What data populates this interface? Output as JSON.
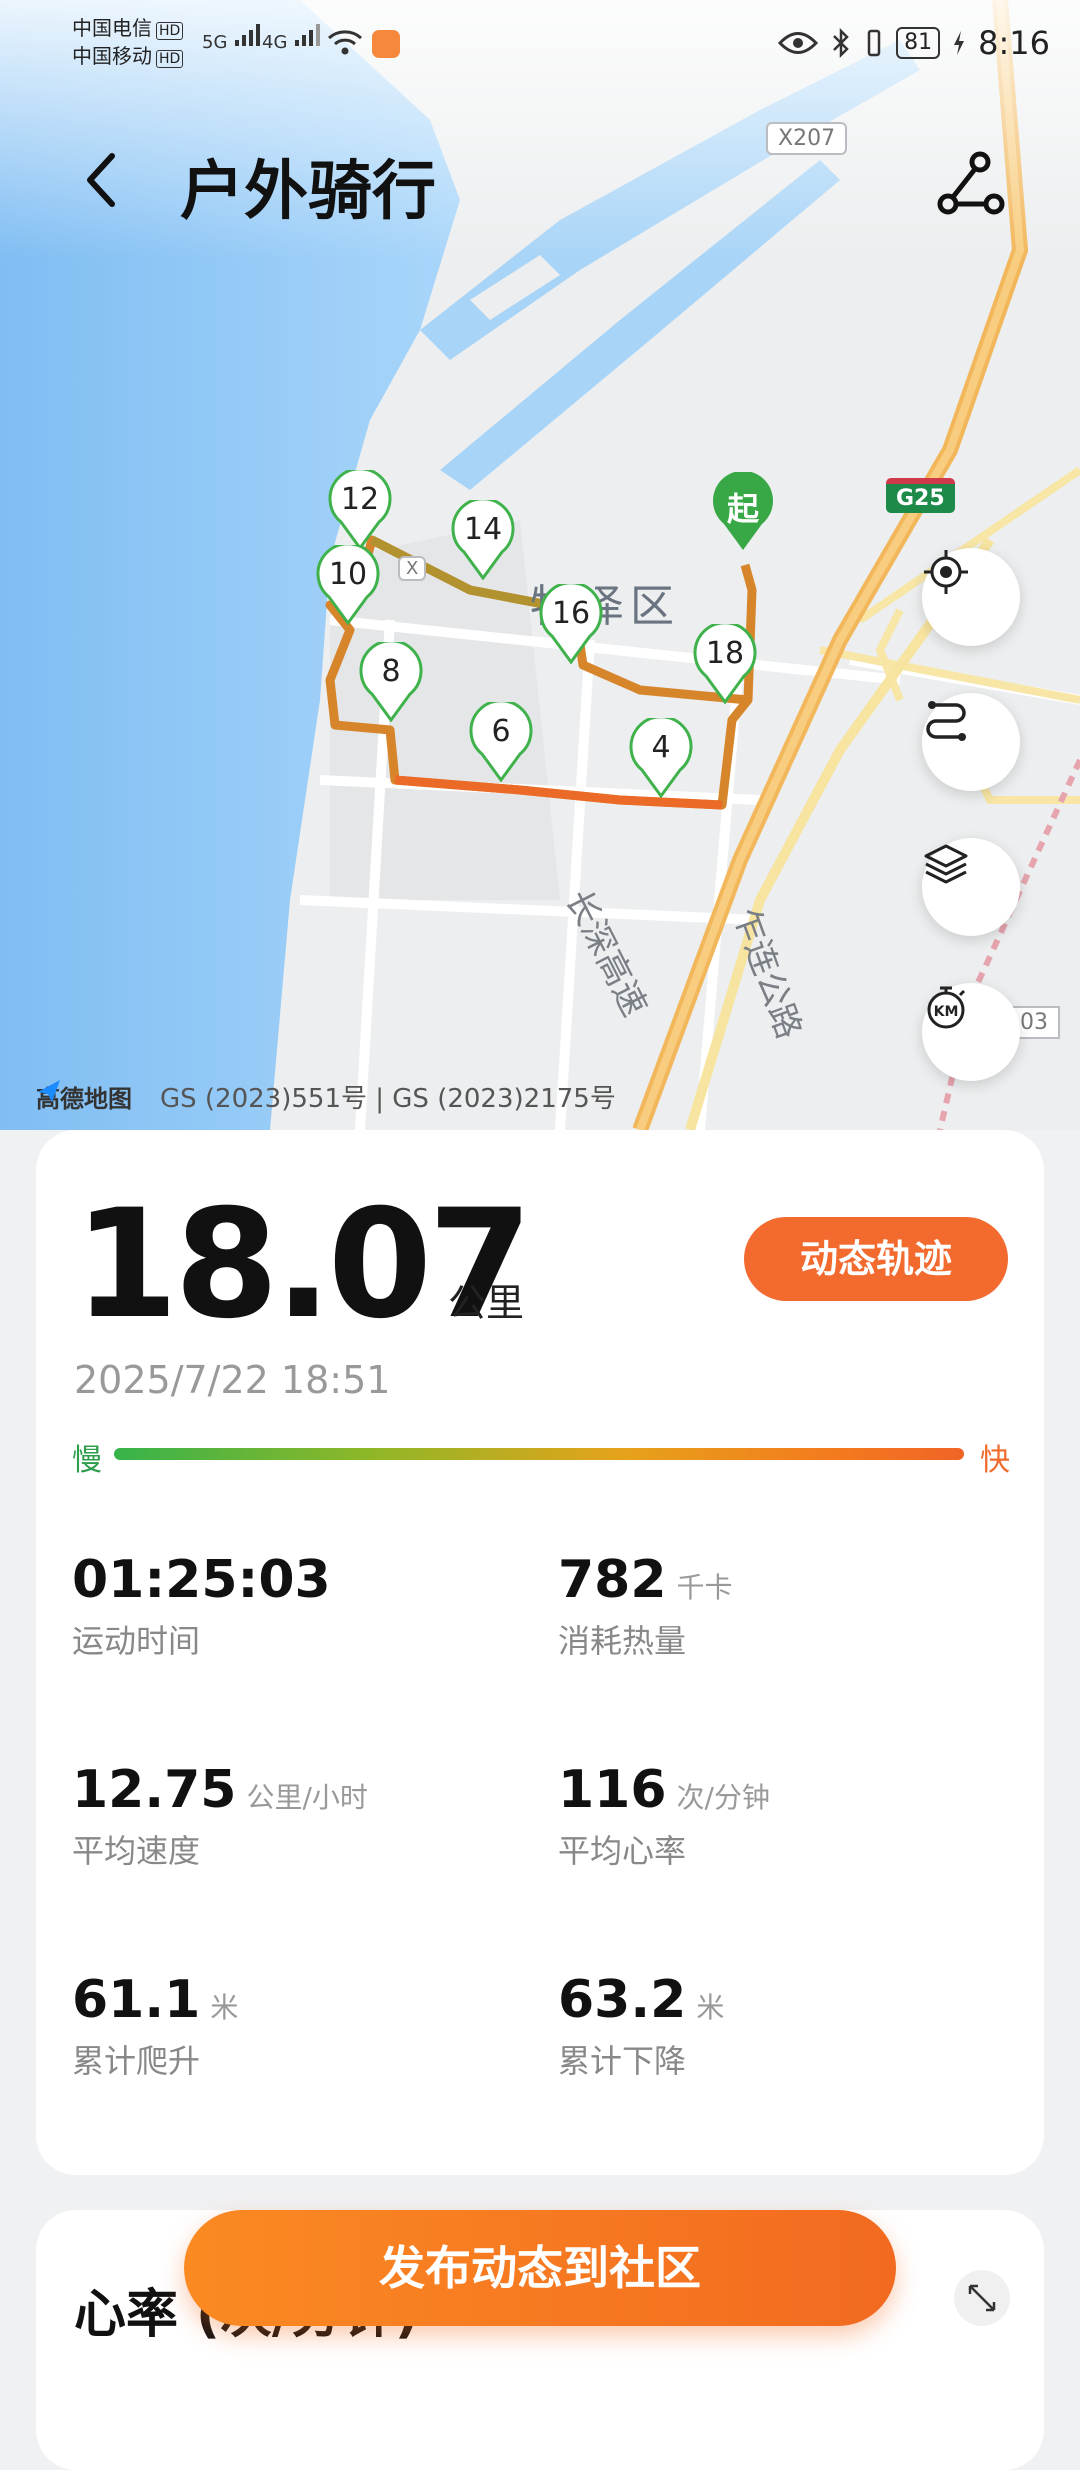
{
  "status_bar": {
    "carrier1": "中国电信",
    "carrier2": "中国移动",
    "hd": "HD",
    "net1": "5G",
    "net2": "4G",
    "battery": "81",
    "time": "8:16"
  },
  "header": {
    "title": "户外骑行"
  },
  "map": {
    "road_tags": [
      "X207",
      "X"
    ],
    "highway_badge": "G25",
    "district": "牡泽区",
    "road1": "长深高速",
    "road2": "乍连公路",
    "edge_tag": "03",
    "start_label": "起",
    "km_markers": [
      "12",
      "14",
      "10",
      "16",
      "8",
      "18",
      "6",
      "4"
    ],
    "provider": "高德地图",
    "license": "GS (2023)551号 | GS (2023)2175号"
  },
  "summary": {
    "distance": "18.07",
    "distance_unit": "公里",
    "track_button": "动态轨迹",
    "datetime": "2025/7/22 18:51",
    "slow_label": "慢",
    "fast_label": "快"
  },
  "stats": [
    {
      "value": "01:25:03",
      "unit": "",
      "label": "运动时间"
    },
    {
      "value": "782",
      "unit": "千卡",
      "label": "消耗热量"
    },
    {
      "value": "12.75",
      "unit": "公里/小时",
      "label": "平均速度"
    },
    {
      "value": "116",
      "unit": "次/分钟",
      "label": "平均心率"
    },
    {
      "value": "61.1",
      "unit": "米",
      "label": "累计爬升"
    },
    {
      "value": "63.2",
      "unit": "米",
      "label": "累计下降"
    }
  ],
  "heart": {
    "title": "心率 (次/分钟)"
  },
  "publish_button": "发布动态到社区",
  "colors": {
    "accent": "#f26a2e",
    "marker_green": "#3fb24c",
    "water": "#8ec8f5"
  }
}
